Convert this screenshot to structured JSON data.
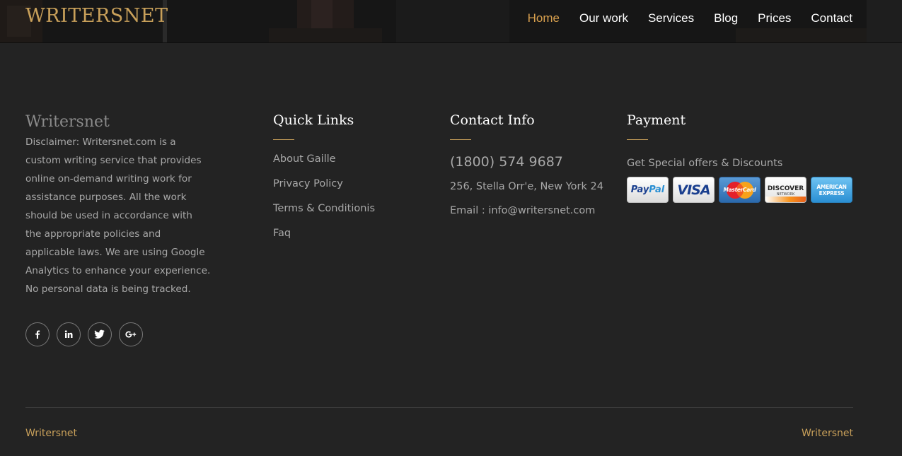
{
  "header": {
    "logo": "WRITERSNET",
    "nav": [
      {
        "label": "Home",
        "active": true
      },
      {
        "label": "Our work"
      },
      {
        "label": "Services"
      },
      {
        "label": "Blog"
      },
      {
        "label": "Prices"
      },
      {
        "label": "Contact"
      }
    ]
  },
  "about": {
    "title": "Writersnet",
    "text": "Disclaimer: Writersnet.com is a custom writing service that provides online on-demand writing work for assistance purposes. All the work should be used in accordance with the appropriate policies and applicable laws. We are using Google Analytics to enhance your experience. No personal data is being tracked."
  },
  "quick_links": {
    "title": "Quick Links",
    "items": [
      "About Gaille",
      "Privacy Policy",
      "Terms & Conditionis",
      "Faq"
    ]
  },
  "contact": {
    "title": "Contact Info",
    "phone": "(1800) 574 9687",
    "address": "256, Stella Orr'e, New York 24",
    "email": "Email : info@writersnet.com"
  },
  "payment": {
    "title": "Payment",
    "text": "Get Special offers & Discounts",
    "cards": {
      "paypal_a": "Pay",
      "paypal_b": "Pal",
      "visa": "VISA",
      "mastercard": "MasterCard",
      "discover": "DISCOVER",
      "discover_sub": "NETWORK",
      "amex_a": "AMERICAN",
      "amex_b": "EXPRESS"
    }
  },
  "social": [
    "facebook-icon",
    "linkedin-icon",
    "twitter-icon",
    "google-plus-icon"
  ],
  "footer": {
    "left": "Writersnet",
    "right": "Writersnet"
  },
  "colors": {
    "background": "#232323",
    "accent": "#c8a05a",
    "nav_active": "#d8a04e",
    "text_muted": "#a8a8a8"
  }
}
